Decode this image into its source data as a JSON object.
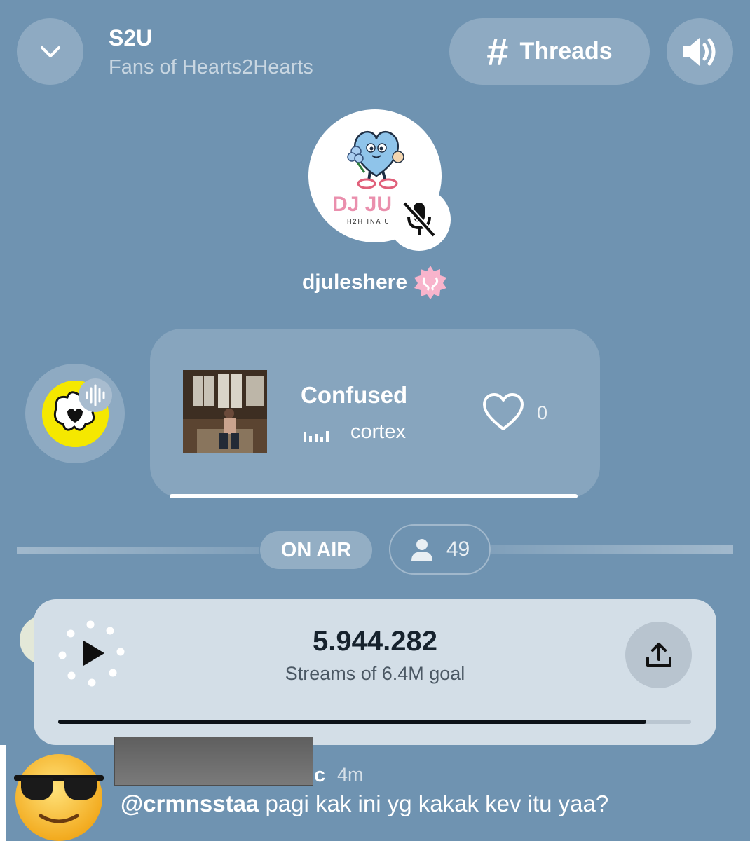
{
  "header": {
    "room_name": "S2U",
    "room_subtitle": "Fans of Hearts2Hearts",
    "threads_label": "Threads"
  },
  "host": {
    "username": "djuleshere",
    "avatar_text": "DJ JU",
    "avatar_subtext": "H2H INA U",
    "muted": true
  },
  "now_playing": {
    "title": "Confused",
    "artist": "cortex",
    "likes": "0"
  },
  "status": {
    "on_air_label": "ON AIR",
    "listener_count": "49"
  },
  "stream_goal": {
    "count": "5.944.282",
    "label": "Streams of 6.4M goal",
    "progress_fraction": 0.929
  },
  "chat": {
    "username_visible_tail": "c",
    "time": "4m",
    "mention": "@crmnsstaa",
    "message": " pagi kak ini yg kakak kev itu yaa?"
  },
  "colors": {
    "background": "#6f93b1",
    "goal_card": "#d3dee7",
    "badge_pink": "#f8b4cc",
    "dj_avatar_yellow": "#f5e800"
  }
}
